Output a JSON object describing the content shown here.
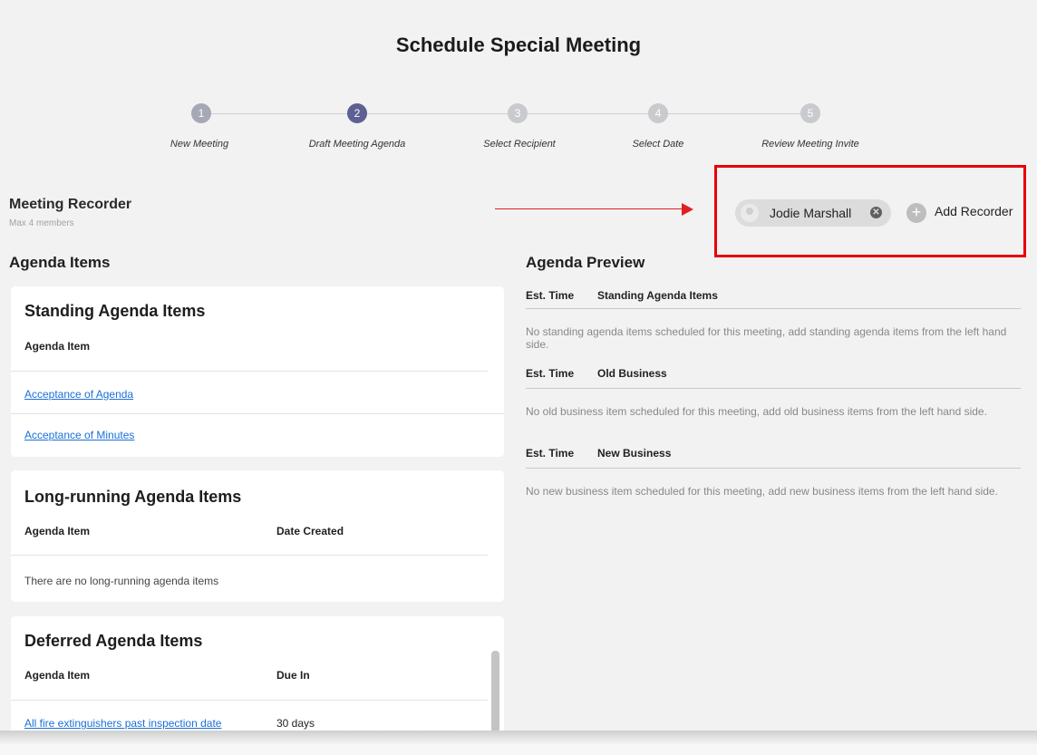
{
  "page": {
    "title": "Schedule Special Meeting"
  },
  "stepper": {
    "steps": [
      {
        "num": "1",
        "label": "New Meeting"
      },
      {
        "num": "2",
        "label": "Draft Meeting Agenda"
      },
      {
        "num": "3",
        "label": "Select Recipient"
      },
      {
        "num": "4",
        "label": "Select Date"
      },
      {
        "num": "5",
        "label": "Review Meeting Invite"
      }
    ],
    "active_step": 2
  },
  "recorder": {
    "title": "Meeting Recorder",
    "subtitle": "Max 4 members",
    "members": [
      {
        "name": "Jodie Marshall"
      }
    ],
    "add_label": "Add Recorder"
  },
  "agenda_items": {
    "heading": "Agenda Items",
    "standing": {
      "title": "Standing Agenda Items",
      "col_item": "Agenda Item",
      "items": [
        "Acceptance of Agenda",
        "Acceptance of Minutes"
      ]
    },
    "long_running": {
      "title": "Long-running Agenda Items",
      "col_item": "Agenda Item",
      "col_date": "Date Created",
      "empty": "There are no long-running agenda items"
    },
    "deferred": {
      "title": "Deferred Agenda Items",
      "col_item": "Agenda Item",
      "col_due": "Due In",
      "rows": [
        {
          "item": "All fire extinguishers past inspection date",
          "due": "30 days"
        }
      ]
    }
  },
  "preview": {
    "heading": "Agenda Preview",
    "sections": [
      {
        "time_label": "Est. Time",
        "name": "Standing Agenda Items",
        "empty": "No standing agenda items scheduled for this meeting, add standing agenda items from the left hand side."
      },
      {
        "time_label": "Est. Time",
        "name": "Old Business",
        "empty": "No old business item scheduled for this meeting, add old business items from the left hand side."
      },
      {
        "time_label": "Est. Time",
        "name": "New Business",
        "empty": "No new business item scheduled for this meeting, add new business items from the left hand side."
      }
    ]
  },
  "colors": {
    "accent": "#5e6094",
    "step_inactive": "#a6a8b6",
    "link": "#1a6fd6",
    "annotation": "#e6000a"
  }
}
